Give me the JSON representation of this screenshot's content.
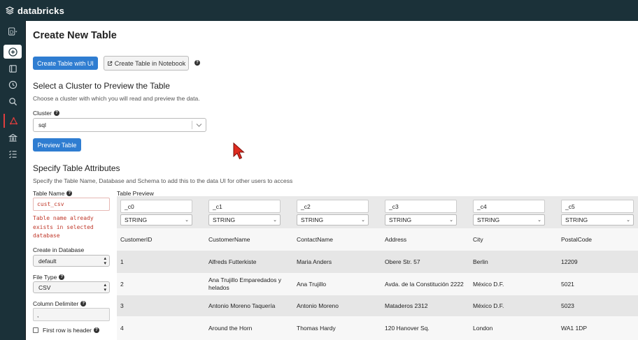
{
  "app": {
    "brand": "databricks"
  },
  "sidebar": {
    "workspace_letter": "D"
  },
  "page": {
    "title": "Create New Table",
    "tabs": {
      "create_ui": "Create Table with UI",
      "create_notebook": "Create Table in Notebook",
      "help": "?"
    }
  },
  "cluster_section": {
    "heading": "Select a Cluster to Preview the Table",
    "description": "Choose a cluster with which you will read and preview the data.",
    "cluster_label": "Cluster",
    "cluster_value": "sql",
    "preview_button": "Preview Table"
  },
  "attributes": {
    "heading": "Specify Table Attributes",
    "description": "Specify the Table Name, Database and Schema to add this to the data UI for other users to access",
    "table_name_label": "Table Name",
    "table_name_value": "cust_csv",
    "error_lines": [
      "Table name already",
      "exists in selected",
      "database"
    ],
    "database_label": "Create in Database",
    "database_value": "default",
    "file_type_label": "File Type",
    "file_type_value": "CSV",
    "delimiter_label": "Column Delimiter",
    "delimiter_value": ",",
    "first_row_label": "First row is header"
  },
  "preview": {
    "label": "Table Preview",
    "columns": [
      {
        "name": "_c0",
        "type": "STRING"
      },
      {
        "name": "_c1",
        "type": "STRING"
      },
      {
        "name": "_c2",
        "type": "STRING"
      },
      {
        "name": "_c3",
        "type": "STRING"
      },
      {
        "name": "_c4",
        "type": "STRING"
      },
      {
        "name": "_c5",
        "type": "STRING"
      }
    ],
    "rows": [
      [
        "CustomerID",
        "CustomerName",
        "ContactName",
        "Address",
        "City",
        "PostalCode"
      ],
      [
        "1",
        "Alfreds Futterkiste",
        "Maria Anders",
        "Obere Str. 57",
        "Berlin",
        "12209"
      ],
      [
        "2",
        "Ana Trujillo Emparedados y helados",
        "Ana Trujillo",
        "Avda. de la Constitución 2222",
        "México D.F.",
        "5021"
      ],
      [
        "3",
        "Antonio Moreno Taquería",
        "Antonio Moreno",
        "Mataderos 2312",
        "México D.F.",
        "5023"
      ],
      [
        "4",
        "Around the Horn",
        "Thomas Hardy",
        "120 Hanover Sq.",
        "London",
        "WA1 1DP"
      ]
    ]
  },
  "colors": {
    "topbar": "#1b3139",
    "primary": "#2f7dd1",
    "error": "#c0392b",
    "cursor": "#e02b1f"
  }
}
